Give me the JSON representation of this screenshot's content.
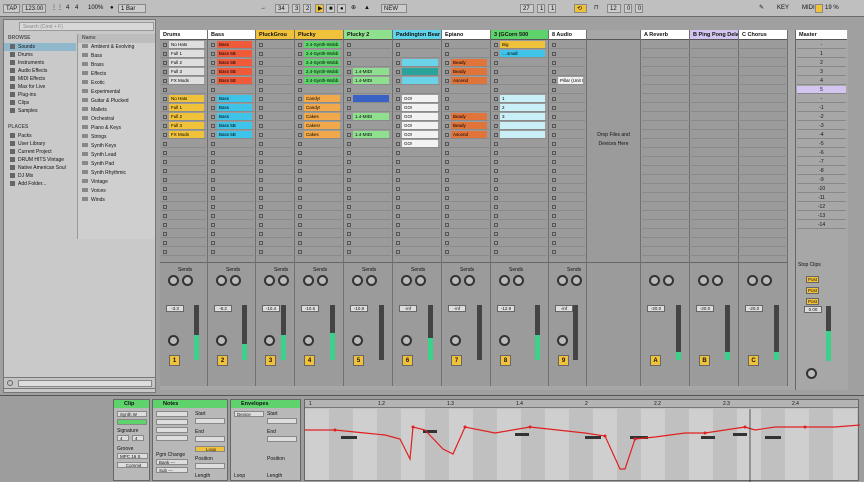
{
  "toolbar": {
    "tap": "TAP",
    "tempo": "123.00",
    "sig_num": "4",
    "sig_den": "4",
    "zoom": "100%",
    "quant": "1 Bar",
    "pos_bar": "34",
    "pos_beat": "3",
    "pos_sixteenth": "2",
    "new_label": "NEW",
    "loop_bar": "27",
    "loop_beat": "1",
    "loop_sixteenth": "1",
    "len_bar": "12",
    "len_beat": "0",
    "len_sixteenth": "0",
    "key_label": "KEY",
    "midi_label": "MIDI",
    "cpu": "19 %",
    "colors": {
      "highlight": "#f0c13b"
    }
  },
  "browser": {
    "search_placeholder": "Search (Cmd + F)",
    "categories_header": "BROWSE",
    "categories": [
      {
        "label": "Sounds",
        "selected": true
      },
      {
        "label": "Drums"
      },
      {
        "label": "Instruments"
      },
      {
        "label": "Audio Effects"
      },
      {
        "label": "MIDI Effects"
      },
      {
        "label": "Max for Live"
      },
      {
        "label": "Plug-ins"
      },
      {
        "label": "Clips"
      },
      {
        "label": "Samples"
      }
    ],
    "places_header": "PLACES",
    "places": [
      "Packs",
      "User Library",
      "Current Project",
      "DRUM HITS Vintage",
      "Native American Soul",
      "DJ Mix",
      "Add Folder..."
    ],
    "name_header": "Name",
    "items": [
      "Ambient & Evolving",
      "Bass",
      "Brass",
      "Effects",
      "Exotic",
      "Experimental",
      "Guitar & Plucked",
      "Mallets",
      "Orchestral",
      "Piano & Keys",
      "Strings",
      "Synth Keys",
      "Synth Lead",
      "Synth Pad",
      "Synth Rhythmic",
      "Vintage",
      "Voices",
      "Winds"
    ]
  },
  "tracks": [
    {
      "name": "Drums",
      "color": "#ffffff",
      "num": "1",
      "vol": "-3.3",
      "clips": [
        {
          "row": 0,
          "label": "No Hats",
          "color": "#dedede"
        },
        {
          "row": 1,
          "label": "Full 1",
          "color": "#dedede"
        },
        {
          "row": 2,
          "label": "Full 2",
          "color": "#dedede"
        },
        {
          "row": 3,
          "label": "Full 3",
          "color": "#dedede"
        },
        {
          "row": 4,
          "label": "FX Mods",
          "color": "#dedede"
        },
        {
          "row": 6,
          "label": "No Hats",
          "color": "#f0c13b"
        },
        {
          "row": 7,
          "label": "Full 1",
          "color": "#f0c13b"
        },
        {
          "row": 8,
          "label": "Full 2",
          "color": "#f0c13b"
        },
        {
          "row": 9,
          "label": "Full 3",
          "color": "#f0c13b"
        },
        {
          "row": 10,
          "label": "FX Mods",
          "color": "#f0c13b"
        }
      ],
      "level": 0.45
    },
    {
      "name": "Bass",
      "color": "#ffffff",
      "num": "2",
      "vol": "-8.2",
      "clips": [
        {
          "row": 0,
          "label": "Bass",
          "color": "#ee5a3a"
        },
        {
          "row": 1,
          "label": "Bass 5B",
          "color": "#ee5a3a"
        },
        {
          "row": 2,
          "label": "Bass 5B",
          "color": "#ee5a3a"
        },
        {
          "row": 3,
          "label": "Bass 5B",
          "color": "#ee5a3a"
        },
        {
          "row": 4,
          "label": "Bass 5B",
          "color": "#ee5a3a"
        },
        {
          "row": 6,
          "label": "Bass",
          "color": "#3fc3e8"
        },
        {
          "row": 7,
          "label": "Bass",
          "color": "#3fc3e8"
        },
        {
          "row": 8,
          "label": "Bass",
          "color": "#3fc3e8"
        },
        {
          "row": 9,
          "label": "Bass 5B",
          "color": "#3fc3e8"
        },
        {
          "row": 10,
          "label": "Bass 5B",
          "color": "#3fc3e8"
        }
      ],
      "level": 0.3
    },
    {
      "name": "PluckGrou",
      "color": "#f0c13b",
      "num": "3",
      "vol": "-10.4",
      "clips": [],
      "level": 0.45
    },
    {
      "name": "Plucky",
      "color": "#f0c13b",
      "num": "4",
      "vol": "-10.6",
      "clips": [
        {
          "row": 0,
          "label": "2.4-Synth-Wobb",
          "color": "#5ed36c"
        },
        {
          "row": 1,
          "label": "2.4-Synth-Wobb",
          "color": "#5ed36c"
        },
        {
          "row": 2,
          "label": "2.4-Synth-Wobb",
          "color": "#5ed36c"
        },
        {
          "row": 3,
          "label": "2.4-Synth-Wobb",
          "color": "#5ed36c"
        },
        {
          "row": 4,
          "label": "2.4-Synth-Wobb",
          "color": "#5ed36c"
        },
        {
          "row": 6,
          "label": "Candy!",
          "color": "#f0a84a"
        },
        {
          "row": 7,
          "label": "Candy!",
          "color": "#f0a84a"
        },
        {
          "row": 8,
          "label": "Cakes",
          "color": "#f0a84a"
        },
        {
          "row": 9,
          "label": "Cakes!",
          "color": "#f0a84a"
        },
        {
          "row": 10,
          "label": "Cakes",
          "color": "#f0a84a"
        }
      ],
      "level": 0.5
    },
    {
      "name": "Plucky 2",
      "color": "#8ee08e",
      "num": "5",
      "vol": "-10.9",
      "clips": [
        {
          "row": 3,
          "label": "1.4-MIDI",
          "color": "#8ee08e"
        },
        {
          "row": 4,
          "label": "1.4-MIDI",
          "color": "#8ee08e"
        },
        {
          "row": 6,
          "label": "",
          "color": "#3a62c4"
        },
        {
          "row": 8,
          "label": "1.4-MIDI",
          "color": "#8ee08e"
        },
        {
          "row": 10,
          "label": "1.4-MIDI",
          "color": "#8ee08e"
        }
      ],
      "level": 0.0
    },
    {
      "name": "Paddington Bear",
      "color": "#5fd3e8",
      "num": "6",
      "vol": "-inf",
      "clips": [
        {
          "row": 2,
          "label": "",
          "color": "#6ad3e8"
        },
        {
          "row": 3,
          "label": "",
          "color": "#2aa39a"
        },
        {
          "row": 4,
          "label": "",
          "color": "#6ad3e8"
        },
        {
          "row": 6,
          "label": "GO!",
          "color": "#f2f2f2"
        },
        {
          "row": 7,
          "label": "GO!",
          "color": "#f2f2f2"
        },
        {
          "row": 8,
          "label": "GO!",
          "color": "#f2f2f2"
        },
        {
          "row": 9,
          "label": "GO!",
          "color": "#f2f2f2"
        },
        {
          "row": 10,
          "label": "GO!",
          "color": "#f2f2f2"
        },
        {
          "row": 11,
          "label": "GO!",
          "color": "#f2f2f2"
        }
      ],
      "level": 0.4
    },
    {
      "name": "Epiano",
      "color": "#ffffff",
      "num": "7",
      "vol": "-inf",
      "clips": [
        {
          "row": 2,
          "label": "Beady",
          "color": "#e0743a"
        },
        {
          "row": 3,
          "label": "Beady",
          "color": "#e0743a"
        },
        {
          "row": 4,
          "label": "Ascend",
          "color": "#e0743a"
        },
        {
          "row": 8,
          "label": "Beady",
          "color": "#e0743a"
        },
        {
          "row": 9,
          "label": "Beady",
          "color": "#e0743a"
        },
        {
          "row": 10,
          "label": "Ascend",
          "color": "#e0743a"
        }
      ],
      "level": 0.0
    },
    {
      "name": "3 (GCorn 500",
      "color": "#5ed36c",
      "num": "8",
      "vol": "-12.9",
      "clips": [
        {
          "row": 0,
          "label": "Big",
          "color": "#f0c13b"
        },
        {
          "row": 1,
          "label": "....small",
          "color": "#3fc3e8"
        },
        {
          "row": 6,
          "label": "1",
          "color": "#c9f0f6"
        },
        {
          "row": 7,
          "label": "2",
          "color": "#c9f0f6"
        },
        {
          "row": 8,
          "label": "3",
          "color": "#c9f0f6"
        },
        {
          "row": 9,
          "label": "",
          "color": "#c9f0f6"
        },
        {
          "row": 10,
          "label": "",
          "color": "#c9f0f6"
        }
      ],
      "level": 0.45
    },
    {
      "name": "8 Audio",
      "color": "#ffffff",
      "num": "9",
      "vol": "-inf",
      "clips": [
        {
          "row": 4,
          "label": "Pillar (Unit t",
          "color": "#f0f0f0"
        }
      ],
      "level": 0.0
    },
    {
      "name": "",
      "color": "#a7a7a7",
      "num": "",
      "vol": "",
      "drop": true,
      "clips": [],
      "level": 0.0
    }
  ],
  "drop_text": "Drop Files and Devices Here",
  "sends_label": "Sends",
  "returns": [
    {
      "name": "A Reverb",
      "color": "#ffffff",
      "letter": "A",
      "vol": "-20.0"
    },
    {
      "name": "B Ping Pong Delay",
      "color": "#d4c5f0",
      "letter": "B",
      "vol": "-20.0"
    },
    {
      "name": "C Chorus",
      "color": "#ffffff",
      "letter": "C",
      "vol": "-20.0"
    }
  ],
  "master": {
    "name": "Master",
    "scenes": [
      "-",
      "1",
      "2",
      "3",
      "4",
      "5",
      "-",
      "-1",
      "-2",
      "-3",
      "-4",
      "-5",
      "-6",
      "-7",
      "-8",
      "-9",
      "-10",
      "-11",
      "-12",
      "-13",
      "-14"
    ],
    "selected_scene": 5,
    "stop_clips": "Stop Clips",
    "vol": "0.00",
    "post": "Post"
  },
  "clip_panel": {
    "title": "Clip",
    "name": "Synth W",
    "signature_label": "Signature",
    "sig": "4",
    "sig2": "4",
    "groove_label": "Groove",
    "groove": "MPC 16 S",
    "commit": "Commit"
  },
  "notes_panel": {
    "title": "Notes",
    "start_label": "Start",
    "end_label": "End",
    "loop": "Loop",
    "position_label": "Position",
    "length_label": "Length",
    "pgm_change": "Pgm Change",
    "bank": "Bank ---",
    "sub": "Sub ---",
    "pgm": "Pgm ---"
  },
  "envelope_panel": {
    "title": "Envelopes",
    "device": "Device",
    "start_label": "Start",
    "end_label": "End",
    "loop_label": "Loop",
    "position_label": "Position",
    "length_label": "Length"
  },
  "editor": {
    "ruler": [
      "1",
      "1.2",
      "1.3",
      "1.4",
      "2",
      "2.2",
      "2.3",
      "2.4"
    ]
  }
}
